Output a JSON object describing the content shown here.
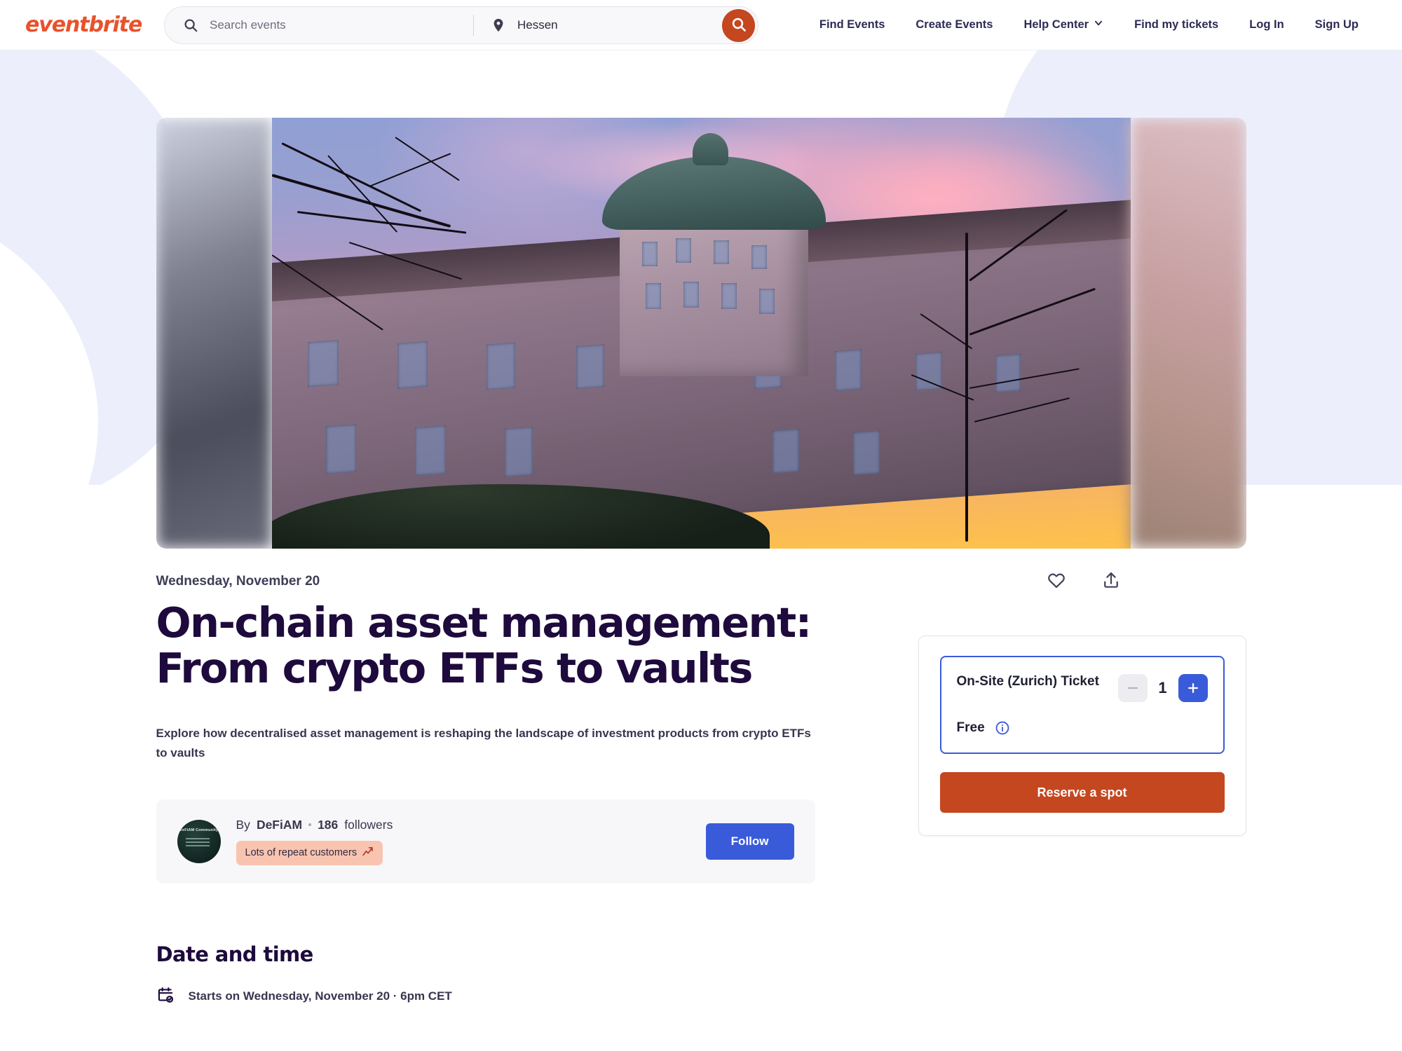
{
  "header": {
    "logo": "eventbrite",
    "search": {
      "events_placeholder": "Search events",
      "events_value": "",
      "location_value": "Hessen",
      "search_button_label": "Search"
    },
    "nav": [
      {
        "label": "Find Events",
        "has_chevron": false
      },
      {
        "label": "Create Events",
        "has_chevron": false
      },
      {
        "label": "Help Center",
        "has_chevron": true
      },
      {
        "label": "Find my tickets",
        "has_chevron": false
      },
      {
        "label": "Log In",
        "has_chevron": false
      },
      {
        "label": "Sign Up",
        "has_chevron": false
      }
    ]
  },
  "event": {
    "date_label": "Wednesday, November 20",
    "title": "On-chain asset management: From crypto ETFs to vaults",
    "summary": "Explore how decentralised asset management is reshaping the landscape of investment products from crypto ETFs to vaults",
    "like_icon": "heart-icon",
    "share_icon": "share-icon"
  },
  "organizer": {
    "by_label": "By",
    "name": "DeFiAM",
    "followers_count": "186",
    "followers_label": "followers",
    "badge_text": "Lots of repeat customers",
    "badge_icon": "chart-increasing-icon",
    "avatar_text": "DeFiAM Community",
    "follow_label": "Follow"
  },
  "tickets": {
    "name": "On-Site (Zurich) Ticket",
    "quantity": "1",
    "decrease_label": "−",
    "increase_label": "+",
    "price": "Free",
    "info_icon": "info-icon",
    "reserve_label": "Reserve a spot"
  },
  "date_time": {
    "heading": "Date and time",
    "icon": "calendar-check-icon",
    "value": "Starts on Wednesday, November 20 · 6pm CET"
  },
  "colors": {
    "brand_orange": "#c4471f",
    "logo_orange": "#e8522c",
    "accent_blue": "#3a5bd9",
    "title_navy": "#1e0a3c",
    "badge_peach": "#f8c4b0",
    "decor_lavender": "#eceffb"
  }
}
